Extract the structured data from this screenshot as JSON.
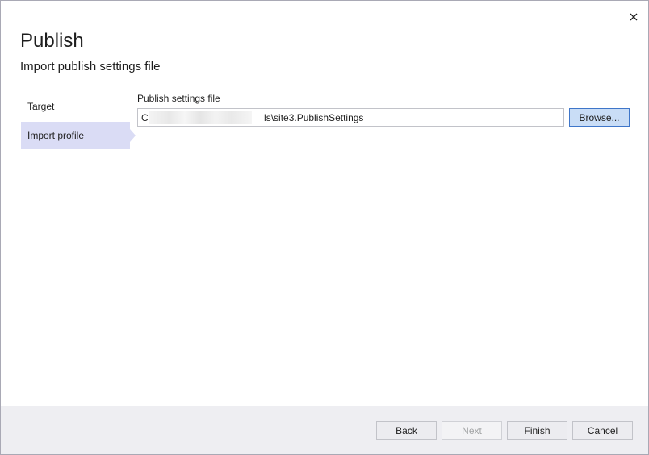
{
  "dialog": {
    "title": "Publish",
    "subtitle": "Import publish settings file",
    "close_icon": "close-icon"
  },
  "nav": {
    "items": [
      {
        "label": "Target",
        "selected": false
      },
      {
        "label": "Import profile",
        "selected": true
      }
    ]
  },
  "form": {
    "field_label": "Publish settings file",
    "path_value": "C:                                          ls\\site3.PublishSettings",
    "browse_label": "Browse..."
  },
  "footer": {
    "back_label": "Back",
    "next_label": "Next",
    "finish_label": "Finish",
    "cancel_label": "Cancel"
  },
  "colors": {
    "accent": "#3f76c9",
    "selected_nav": "#dadcf5",
    "footer_bg": "#eeeef2"
  }
}
